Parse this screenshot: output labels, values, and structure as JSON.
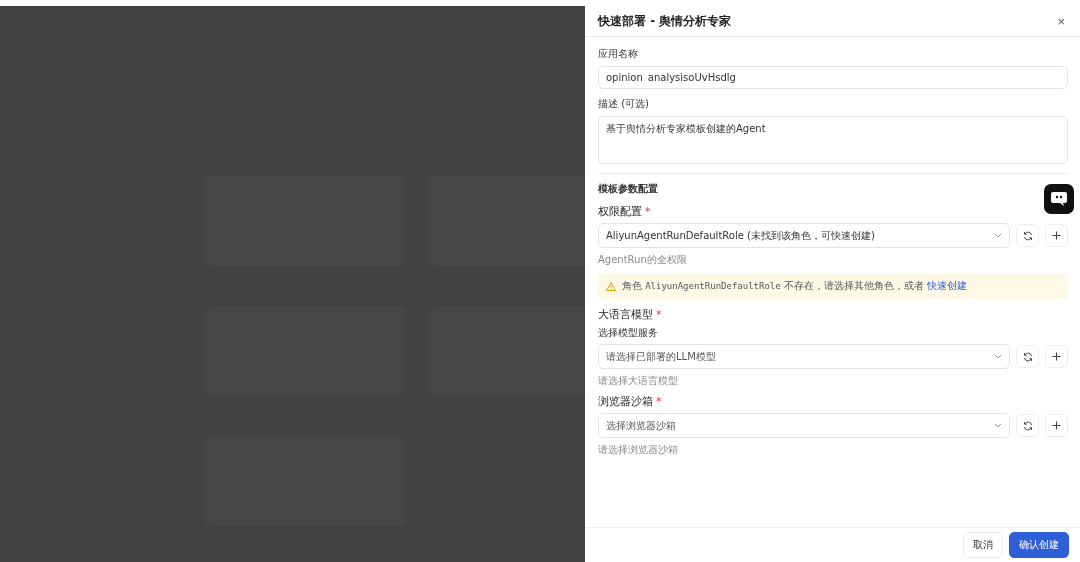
{
  "drawer": {
    "title": "快速部署 - 舆情分析专家",
    "close": "×"
  },
  "fields": [
    {
      "kind": "input",
      "label": "应用名称",
      "value": "opinion_analysisoUvHsdlg"
    },
    {
      "kind": "textarea",
      "label": "描述 (可选)",
      "value": "基于舆情分析专家模板创建的Agent"
    }
  ],
  "section_title": "模板参数配置",
  "params": [
    {
      "label": "权限配置",
      "required_mark": "*",
      "value": "AliyunAgentRunDefaultRole (未找到该角色，可快速创建)",
      "hint": "AgentRun的全权限",
      "alert": {
        "before": "角色 ",
        "code": "AliyunAgentRunDefaultRole",
        "after": " 不存在，请选择其他角色，或者 ",
        "link": "快速创建"
      }
    },
    {
      "label": "大语言模型",
      "required_mark": "*",
      "sublabel": "选择模型服务",
      "placeholder": "请选择已部署的LLM模型",
      "hint": "请选择大语言模型"
    },
    {
      "label": "浏览器沙箱",
      "required_mark": "*",
      "placeholder": "选择浏览器沙箱",
      "hint": "请选择浏览器沙箱"
    }
  ],
  "buttons": [
    {
      "kind": "secondary",
      "label": "取消"
    },
    {
      "kind": "primary",
      "label": "确认创建"
    }
  ]
}
